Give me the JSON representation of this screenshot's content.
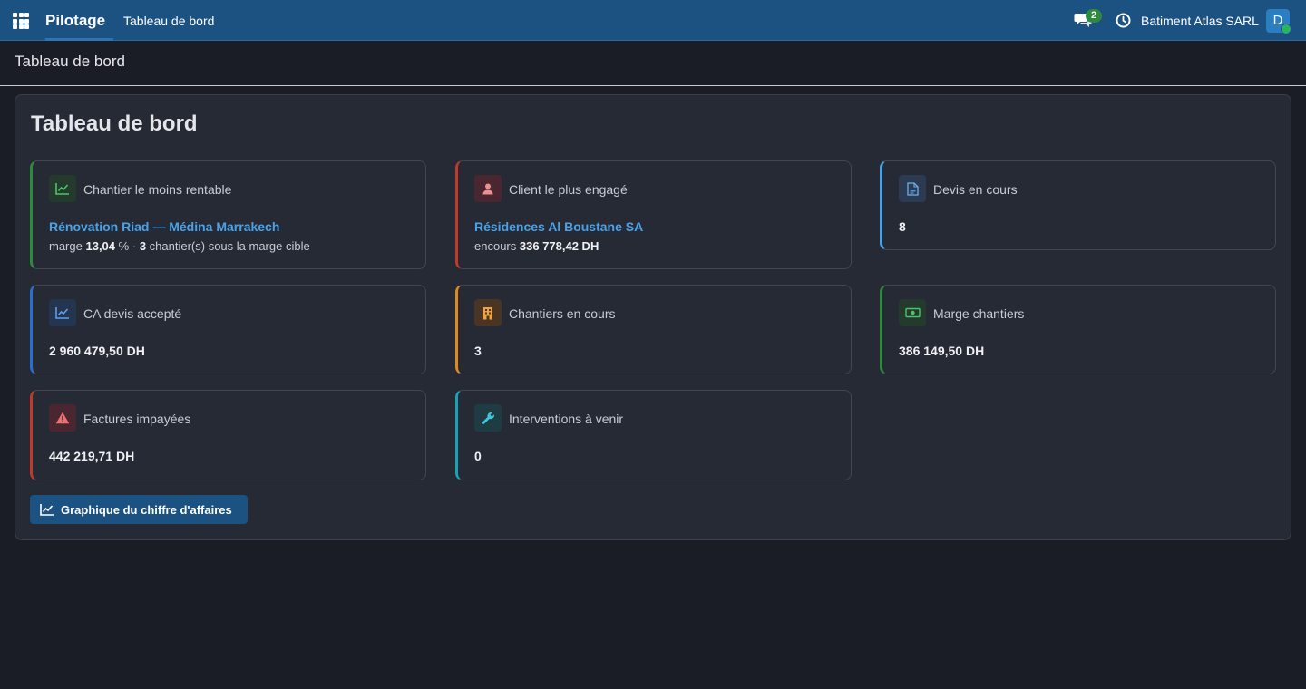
{
  "topbar": {
    "app_name": "Pilotage",
    "menu_item": "Tableau de bord",
    "chat_count": "2",
    "company": "Batiment Atlas SARL",
    "avatar_letter": "D",
    "colors": {
      "bar": "#1c5281",
      "badge": "#2f8a3e",
      "avatar": "#2a7fc2"
    }
  },
  "breadcrumb": "Tableau de bord",
  "panel": {
    "title": "Tableau de bord"
  },
  "cards": [
    {
      "title": "Chantier le moins rentable",
      "icon": "trend-up-icon",
      "accent": "#2e8b3e",
      "link": "Rénovation Riad — Médina Marrakech",
      "detail": {
        "prefix": "marge",
        "margin": "13,04",
        "unit": "%",
        "sep": "·",
        "count": "3",
        "suffix": "chantier(s) sous la marge cible"
      }
    },
    {
      "title": "Client le plus engagé",
      "icon": "user-icon",
      "accent": "#c0392b",
      "link": "Résidences Al Boustane SA",
      "detail": {
        "prefix": "encours",
        "amount": "336 778,42 DH"
      }
    },
    {
      "title": "Devis en cours",
      "icon": "file-icon",
      "accent": "#4aa3e8",
      "value": "8"
    },
    {
      "title": "CA devis accepté",
      "icon": "trend-up-icon",
      "accent": "#2a6fcf",
      "value": "2 960 479,50 DH"
    },
    {
      "title": "Chantiers en cours",
      "icon": "building-icon",
      "accent": "#e08a1e",
      "value": "3"
    },
    {
      "title": "Marge chantiers",
      "icon": "money-icon",
      "accent": "#2e8b3e",
      "value": "386 149,50 DH"
    },
    {
      "title": "Factures impayées",
      "icon": "warning-icon",
      "accent": "#c0392b",
      "value": "442 219,71 DH"
    },
    {
      "title": "Interventions à venir",
      "icon": "wrench-icon",
      "accent": "#17a2b8",
      "value": "0"
    }
  ],
  "revenue_chart_button": "Graphique du chiffre d'affaires"
}
